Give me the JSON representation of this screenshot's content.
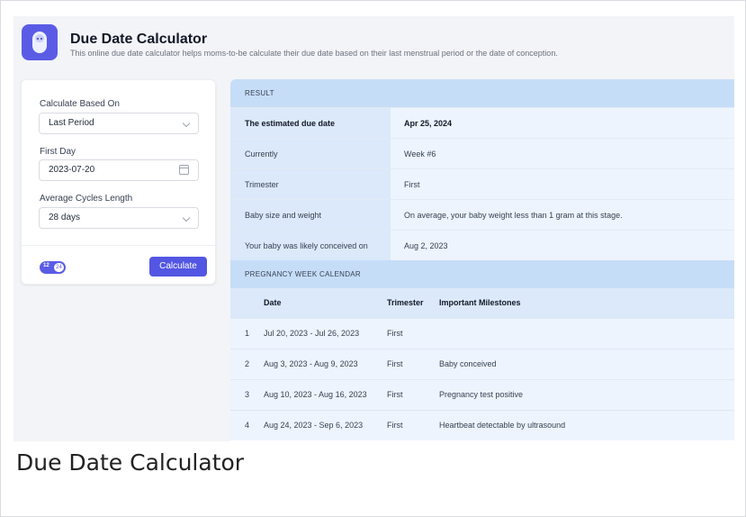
{
  "header": {
    "icon": "baby-icon",
    "title": "Due Date Calculator",
    "subtitle": "This online due date calculator helps moms-to-be calculate their due date based on their last menstrual period or the date of conception."
  },
  "form": {
    "basis_label": "Calculate Based On",
    "basis_value": "Last Period",
    "first_day_label": "First Day",
    "first_day_value": "2023-07-20",
    "cycle_label": "Average Cycles Length",
    "cycle_value": "28 days",
    "toggle_on": "12",
    "toggle_off": "24",
    "calculate_label": "Calculate"
  },
  "result": {
    "heading": "RESULT",
    "rows": [
      {
        "key": "The estimated due date",
        "value": "Apr 25, 2024"
      },
      {
        "key": "Currently",
        "value": "Week #6"
      },
      {
        "key": "Trimester",
        "value": "First"
      },
      {
        "key": "Baby size and weight",
        "value": "On average, your baby weight less than 1 gram at this stage."
      },
      {
        "key": "Your baby was likely conceived on",
        "value": "Aug 2, 2023"
      }
    ]
  },
  "calendar": {
    "heading": "PREGNANCY WEEK CALENDAR",
    "columns": {
      "date": "Date",
      "trimester": "Trimester",
      "milestones": "Important Milestones"
    },
    "rows": [
      {
        "num": "1",
        "date": "Jul 20, 2023 - Jul 26, 2023",
        "trimester": "First",
        "milestone": ""
      },
      {
        "num": "2",
        "date": "Aug 3, 2023 - Aug 9, 2023",
        "trimester": "First",
        "milestone": "Baby conceived"
      },
      {
        "num": "3",
        "date": "Aug 10, 2023 - Aug 16, 2023",
        "trimester": "First",
        "milestone": "Pregnancy test positive"
      },
      {
        "num": "4",
        "date": "Aug 24, 2023 - Sep 6, 2023",
        "trimester": "First",
        "milestone": "Heartbeat detectable by ultrasound"
      }
    ]
  },
  "caption": "Due Date Calculator",
  "colors": {
    "accent": "#5356e2",
    "result_header": "#c6ddf8",
    "row_key": "#dbe9fa",
    "row_value": "#edf4fd"
  }
}
